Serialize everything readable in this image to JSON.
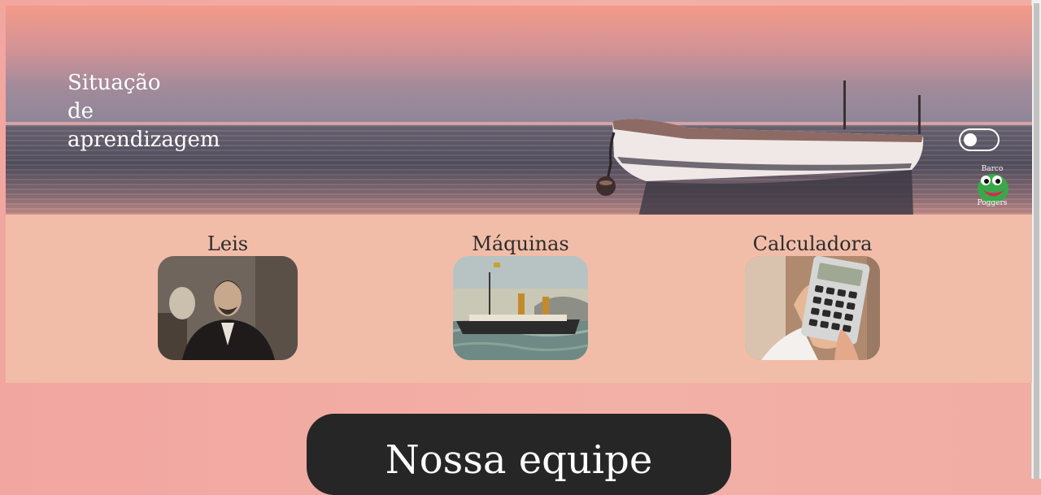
{
  "header": {
    "title_lines": [
      "Situação",
      "de",
      "aprendizagem"
    ],
    "logo": {
      "top_text": "Barco",
      "bottom_text": "Poggers",
      "icon": "frog-face-icon"
    },
    "theme_toggle": {
      "state": "off",
      "icon": "toggle-switch-icon"
    }
  },
  "cards": [
    {
      "label": "Leis",
      "image": "portrait-of-man-in-black-suit"
    },
    {
      "label": "Máquinas",
      "image": "steamship-on-sea"
    },
    {
      "label": "Calculadora",
      "image": "hand-holding-calculator"
    }
  ],
  "team": {
    "title": "Nossa equipe"
  },
  "colors": {
    "page_background": "#f2a6a0",
    "cards_background": "#f1bda9",
    "team_background": "#272626",
    "text_dark": "#2d2d2d"
  }
}
